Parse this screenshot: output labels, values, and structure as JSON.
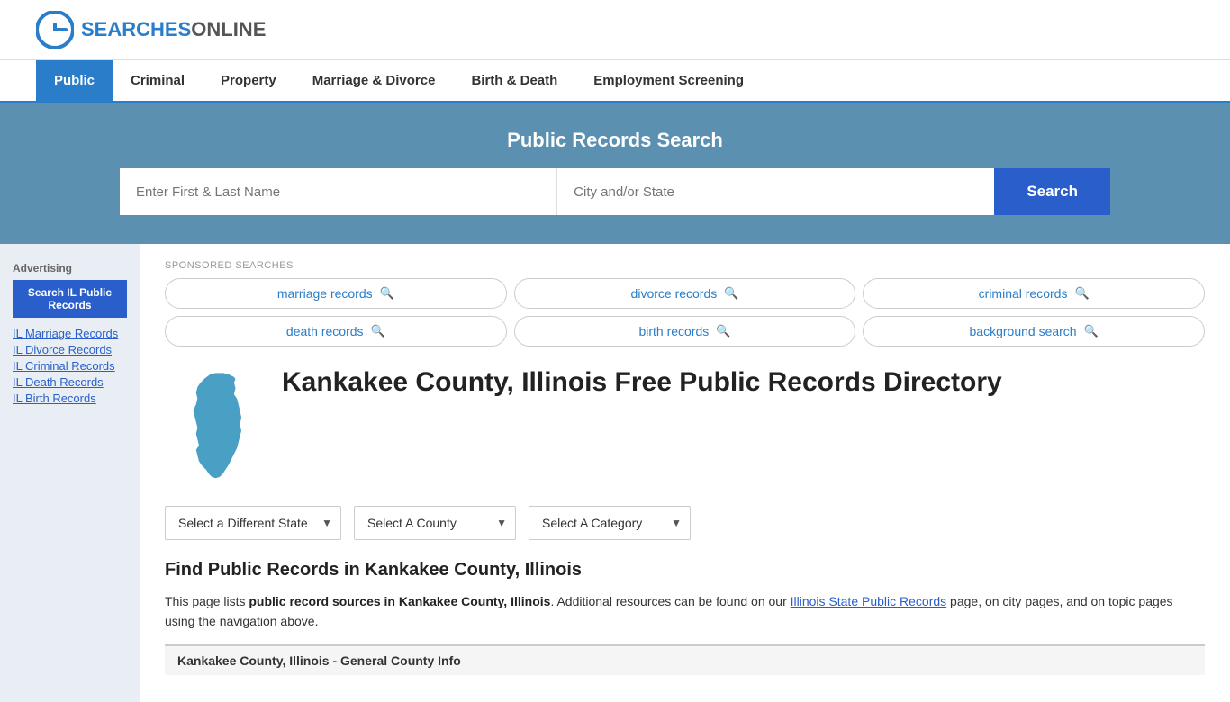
{
  "header": {
    "logo_text_dark": "ONLINE",
    "logo_text_blue": "SEARCHES",
    "logo_alt": "OnlineSearches logo"
  },
  "nav": {
    "items": [
      {
        "label": "Public",
        "active": true
      },
      {
        "label": "Criminal",
        "active": false
      },
      {
        "label": "Property",
        "active": false
      },
      {
        "label": "Marriage & Divorce",
        "active": false
      },
      {
        "label": "Birth & Death",
        "active": false
      },
      {
        "label": "Employment Screening",
        "active": false
      }
    ]
  },
  "search_banner": {
    "title": "Public Records Search",
    "name_placeholder": "Enter First & Last Name",
    "location_placeholder": "City and/or State",
    "button_label": "Search"
  },
  "sponsored": {
    "label": "SPONSORED SEARCHES",
    "tags": [
      {
        "label": "marriage records"
      },
      {
        "label": "divorce records"
      },
      {
        "label": "criminal records"
      },
      {
        "label": "death records"
      },
      {
        "label": "birth records"
      },
      {
        "label": "background search"
      }
    ]
  },
  "page": {
    "title": "Kankakee County, Illinois Free Public Records Directory",
    "sub_heading": "Find Public Records in Kankakee County, Illinois",
    "description_text": "This page lists ",
    "description_bold": "public record sources in Kankakee County, Illinois",
    "description_rest": ". Additional resources can be found on our ",
    "description_link": "Illinois State Public Records",
    "description_end": " page, on city pages, and on topic pages using the navigation above."
  },
  "dropdowns": {
    "state": {
      "placeholder": "Select a Different State",
      "options": [
        "Select a Different State"
      ]
    },
    "county": {
      "placeholder": "Select A County",
      "options": [
        "Select A County"
      ]
    },
    "category": {
      "placeholder": "Select A Category",
      "options": [
        "Select A Category"
      ]
    }
  },
  "sidebar": {
    "ad_label": "Advertising",
    "ad_button": "Search IL Public Records",
    "links": [
      {
        "label": "IL Marriage Records"
      },
      {
        "label": "IL Divorce Records"
      },
      {
        "label": "IL Criminal Records"
      },
      {
        "label": "IL Death Records"
      },
      {
        "label": "IL Birth Records"
      }
    ]
  },
  "general_info": {
    "bar_label": "Kankakee County, Illinois - General County Info"
  }
}
